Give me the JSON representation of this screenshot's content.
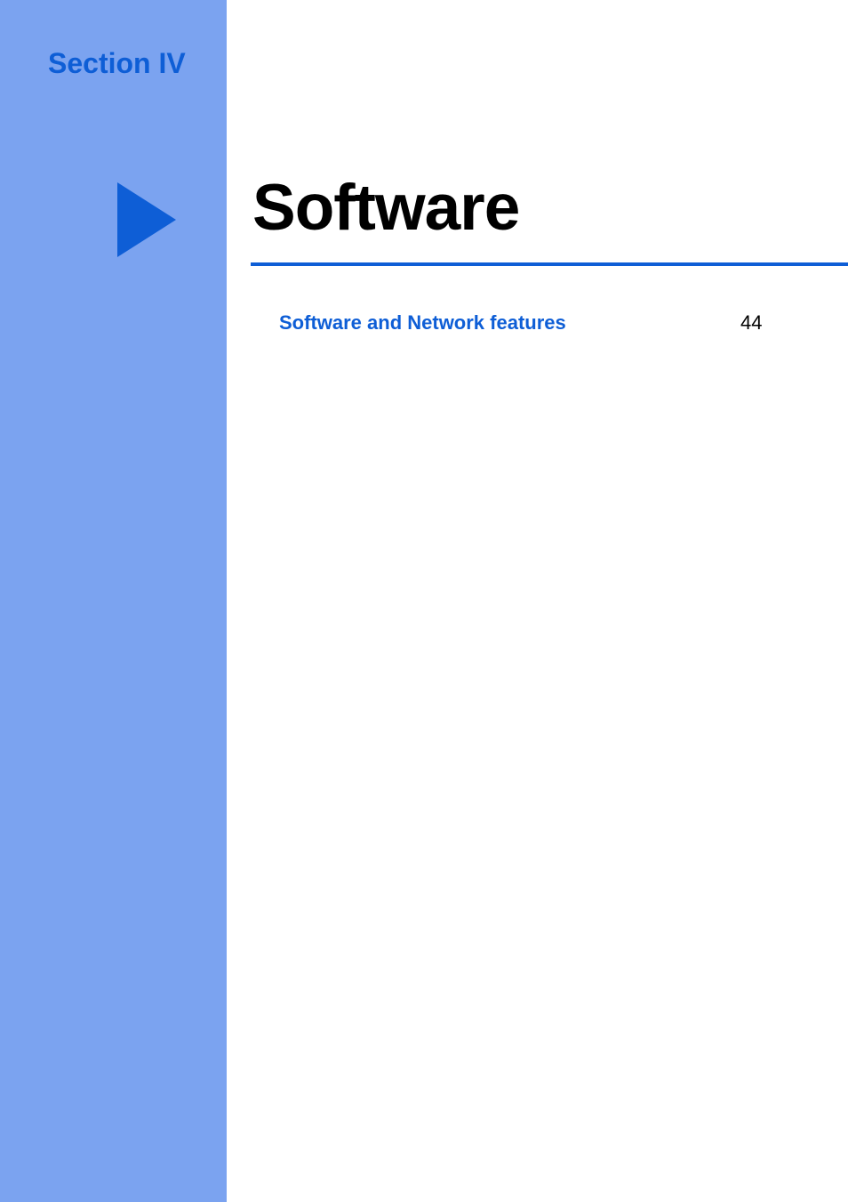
{
  "header": {
    "section_label": "Section IV"
  },
  "title": {
    "heading": "Software"
  },
  "toc": {
    "entry_label": "Software and Network features",
    "page_number": "44"
  }
}
